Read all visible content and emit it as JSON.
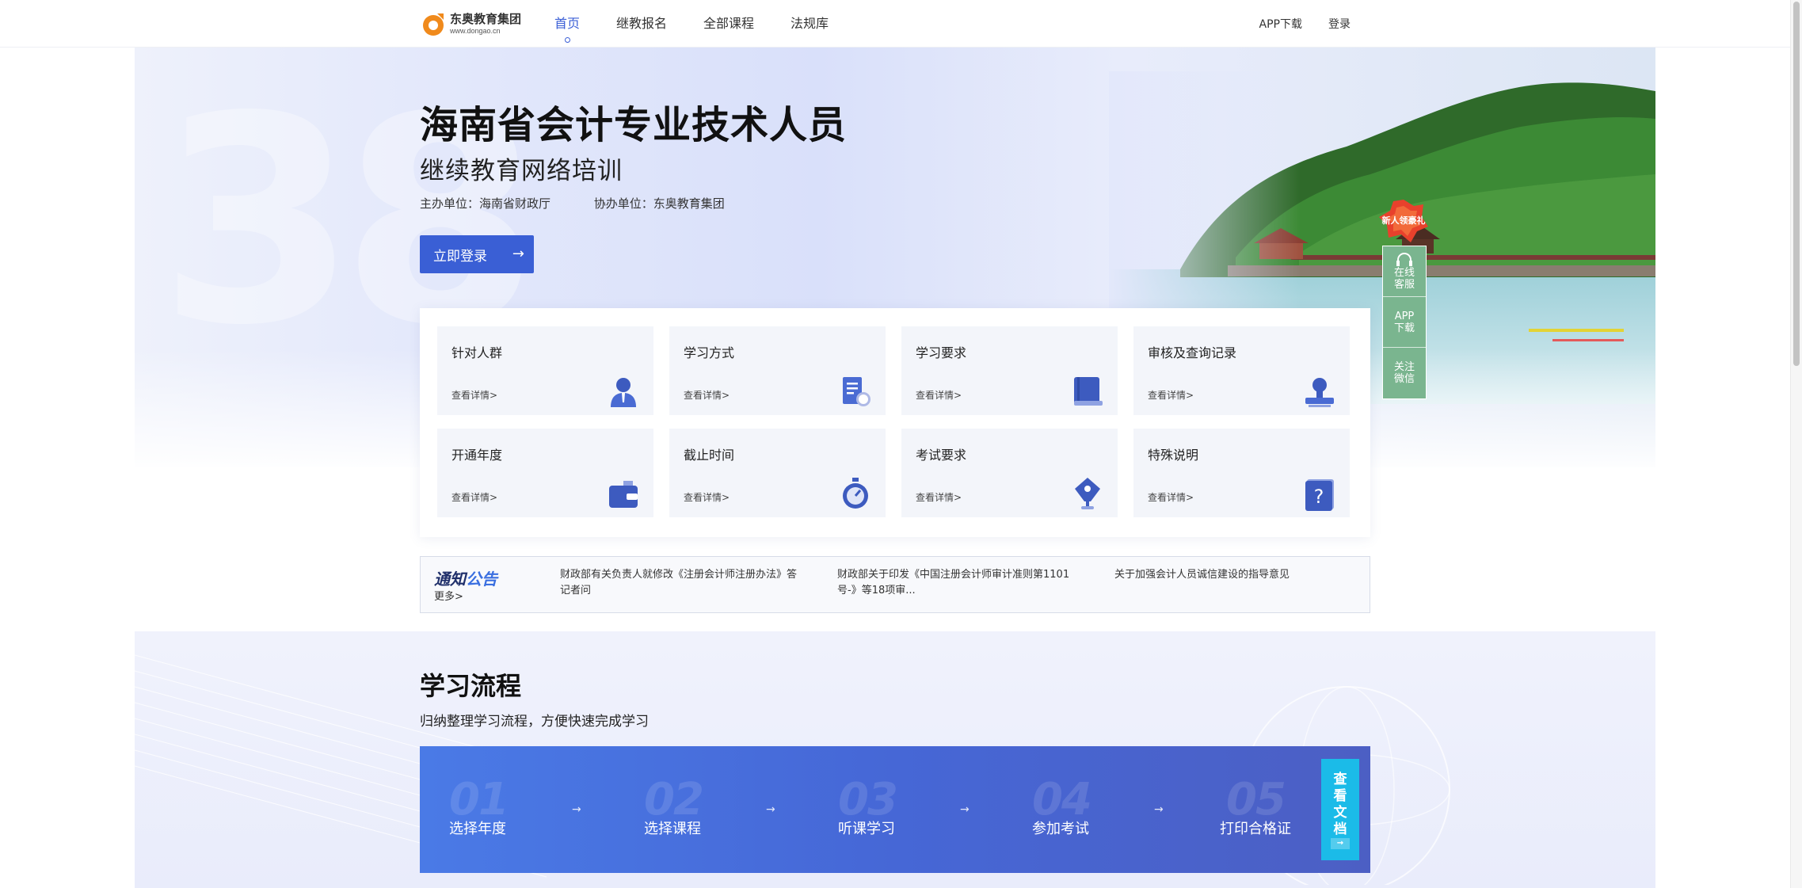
{
  "header": {
    "logo_name": "东奥教育集团",
    "logo_url": "www.dongao.cn",
    "nav": [
      {
        "label": "首页",
        "active": true
      },
      {
        "label": "继教报名",
        "active": false
      },
      {
        "label": "全部课程",
        "active": false
      },
      {
        "label": "法规库",
        "active": false
      }
    ],
    "app_download": "APP下载",
    "login": "登录"
  },
  "hero": {
    "title": "海南省会计专业技术人员",
    "subtitle": "继续教育网络培训",
    "host": "主办单位：海南省财政厅",
    "co_host": "协办单位：东奥教育集团",
    "login_button": "立即登录",
    "login_arrow": "→",
    "watermark": "38"
  },
  "side_widget": {
    "gift_label": "新人领豪礼",
    "items": [
      {
        "label": "在线客服",
        "line1": "在线",
        "line2": "客服",
        "icon": "headset-icon"
      },
      {
        "label": "APP下载",
        "line1": "APP",
        "line2": "下载",
        "icon": "phone-icon"
      },
      {
        "label": "关注微信",
        "line1": "关注",
        "line2": "微信",
        "icon": "wechat-icon"
      }
    ]
  },
  "info_tiles": [
    {
      "title": "针对人群",
      "link": "查看详情>",
      "icon": "person-group-icon"
    },
    {
      "title": "学习方式",
      "link": "查看详情>",
      "icon": "document-fee-icon"
    },
    {
      "title": "学习要求",
      "link": "查看详情>",
      "icon": "book-icon"
    },
    {
      "title": "审核及查询记录",
      "link": "查看详情>",
      "icon": "stamp-icon"
    },
    {
      "title": "开通年度",
      "link": "查看详情>",
      "icon": "wallet-icon"
    },
    {
      "title": "截止时间",
      "link": "查看详情>",
      "icon": "stopwatch-icon"
    },
    {
      "title": "考试要求",
      "link": "查看详情>",
      "icon": "pen-nib-icon"
    },
    {
      "title": "特殊说明",
      "link": "查看详情>",
      "icon": "question-icon"
    }
  ],
  "notice": {
    "label_a": "通知",
    "label_b": "公告",
    "more": "更多>",
    "items": [
      "财政部有关负责人就修改《注册会计师注册办法》答记者问",
      "财政部关于印发《中国注册会计师审计准则第1101号-》等18项审...",
      "关于加强会计人员诚信建设的指导意见"
    ]
  },
  "process": {
    "title": "学习流程",
    "subtitle": "归纳整理学习流程，方便快速完成学习",
    "steps": [
      {
        "num": "01",
        "label": "选择年度"
      },
      {
        "num": "02",
        "label": "选择课程"
      },
      {
        "num": "03",
        "label": "听课学习"
      },
      {
        "num": "04",
        "label": "参加考试"
      },
      {
        "num": "05",
        "label": "打印合格证"
      }
    ],
    "step_arrow": "→",
    "doc_button": "查看文档",
    "doc_arrow": "→"
  },
  "colors": {
    "accent": "#3a5fd5",
    "side_green": "#7ab58f",
    "doc_button": "#1bbbe8",
    "banner_start": "#4a7ae6",
    "banner_end": "#4c5fc4"
  }
}
